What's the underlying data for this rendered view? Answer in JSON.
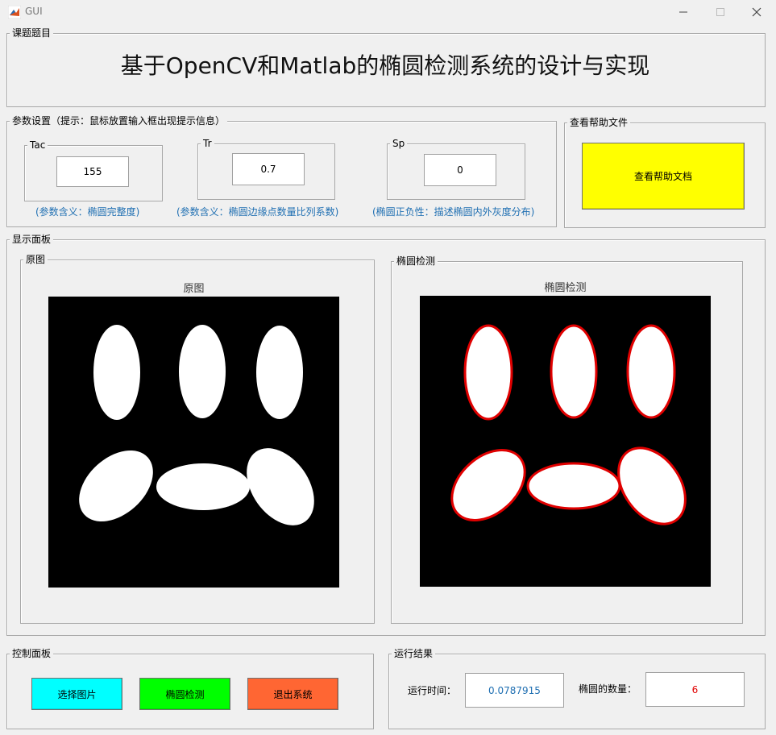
{
  "window": {
    "title": "GUI"
  },
  "topic_panel": {
    "legend": "课题题目",
    "title": "基于OpenCV和Matlab的椭圆检测系统的设计与实现"
  },
  "params_panel": {
    "legend": "参数设置（提示：鼠标放置输入框出现提示信息）",
    "tac": {
      "label": "Tac",
      "value": "155",
      "hint": "(参数含义：椭圆完整度)"
    },
    "tr": {
      "label": "Tr",
      "value": "0.7",
      "hint": "(参数含义：椭圆边缘点数量比列系数)"
    },
    "sp": {
      "label": "Sp",
      "value": "0",
      "hint": "(椭圆正负性：描述椭圆内外灰度分布)"
    }
  },
  "help_panel": {
    "legend": "查看帮助文件",
    "button_label": "查看帮助文档"
  },
  "display_panel": {
    "legend": "显示面板",
    "original": {
      "legend": "原图",
      "axes_title": "原图"
    },
    "detection": {
      "legend": "椭圆检测",
      "axes_title": "椭圆检测"
    }
  },
  "control_panel": {
    "legend": "控制面板",
    "select_label": "选择图片",
    "detect_label": "椭圆检测",
    "exit_label": "退出系统"
  },
  "result_panel": {
    "legend": "运行结果",
    "time_label": "运行时间：",
    "time_value": "0.0787915",
    "count_label": "椭圆的数量：",
    "count_value": "6"
  },
  "colors": {
    "help_button": "#ffff00",
    "select_button": "#00ffff",
    "detect_button": "#00ff00",
    "exit_button": "#ff6633",
    "ellipse_outline": "#e00000",
    "hint_text": "#1f6fb2"
  }
}
